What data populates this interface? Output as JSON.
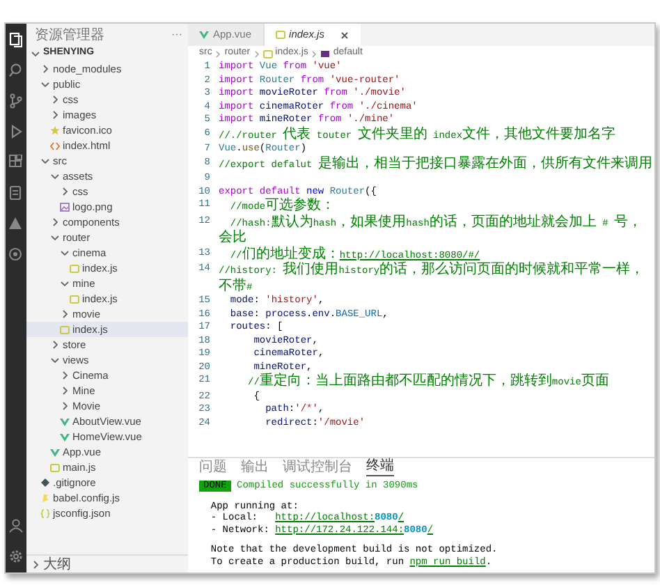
{
  "sidebar": {
    "title": "资源管理器",
    "more": "···",
    "tree": [
      {
        "label": "SHENYING",
        "kind": "folder",
        "expanded": true,
        "selected": false,
        "children": [
          {
            "label": "node_modules",
            "kind": "folder",
            "expanded": false,
            "selected": false
          },
          {
            "label": "public",
            "kind": "folder",
            "expanded": true,
            "selected": false,
            "children": [
              {
                "label": "css",
                "kind": "folder",
                "expanded": false,
                "selected": false
              },
              {
                "label": "images",
                "kind": "folder",
                "expanded": false,
                "selected": false
              },
              {
                "label": "favicon.ico",
                "kind": "ico",
                "selected": false
              },
              {
                "label": "index.html",
                "kind": "html",
                "selected": false
              }
            ]
          },
          {
            "label": "src",
            "kind": "folder",
            "expanded": true,
            "selected": false,
            "children": [
              {
                "label": "assets",
                "kind": "folder",
                "expanded": true,
                "selected": false,
                "children": [
                  {
                    "label": "css",
                    "kind": "folder",
                    "expanded": false,
                    "selected": false
                  },
                  {
                    "label": "logo.png",
                    "kind": "png",
                    "selected": false
                  }
                ]
              },
              {
                "label": "components",
                "kind": "folder",
                "expanded": false,
                "selected": false
              },
              {
                "label": "router",
                "kind": "folder",
                "expanded": true,
                "selected": false,
                "children": [
                  {
                    "label": "cinema",
                    "kind": "folder",
                    "expanded": true,
                    "selected": false,
                    "children": [
                      {
                        "label": "index.js",
                        "kind": "js",
                        "selected": false
                      }
                    ]
                  },
                  {
                    "label": "mine",
                    "kind": "folder",
                    "expanded": true,
                    "selected": false,
                    "children": [
                      {
                        "label": "index.js",
                        "kind": "js",
                        "selected": false
                      }
                    ]
                  },
                  {
                    "label": "movie",
                    "kind": "folder",
                    "expanded": false,
                    "selected": false
                  },
                  {
                    "label": "index.js",
                    "kind": "js",
                    "selected": true
                  }
                ]
              },
              {
                "label": "store",
                "kind": "folder",
                "expanded": false,
                "selected": false
              },
              {
                "label": "views",
                "kind": "folder",
                "expanded": true,
                "selected": false,
                "children": [
                  {
                    "label": "Cinema",
                    "kind": "folder",
                    "expanded": false,
                    "selected": false
                  },
                  {
                    "label": "Mine",
                    "kind": "folder",
                    "expanded": false,
                    "selected": false
                  },
                  {
                    "label": "Movie",
                    "kind": "folder",
                    "expanded": false,
                    "selected": false
                  },
                  {
                    "label": "AboutView.vue",
                    "kind": "vue",
                    "selected": false
                  },
                  {
                    "label": "HomeView.vue",
                    "kind": "vue",
                    "selected": false
                  }
                ]
              },
              {
                "label": "App.vue",
                "kind": "vue",
                "selected": false
              },
              {
                "label": "main.js",
                "kind": "js",
                "selected": false
              }
            ]
          },
          {
            "label": ".gitignore",
            "kind": "git",
            "selected": false
          },
          {
            "label": "babel.config.js",
            "kind": "babel",
            "selected": false
          },
          {
            "label": "jsconfig.json",
            "kind": "json",
            "selected": false
          }
        ]
      }
    ],
    "outline": {
      "label": "大纲",
      "expanded": false
    }
  },
  "editor": {
    "tabs": [
      {
        "label": "App.vue",
        "kind": "vue",
        "selected": false
      },
      {
        "label": "index.js",
        "kind": "js",
        "selected": true
      }
    ],
    "breadcrumb": [
      {
        "label": "src",
        "kind": "folder"
      },
      {
        "label": "router",
        "kind": "folder"
      },
      {
        "label": "index.js",
        "kind": "js"
      },
      {
        "label": "default",
        "kind": "symbol"
      }
    ],
    "lines": [
      {
        "number": "1",
        "tokens": [
          {
            "kind": "keyword",
            "text": "import"
          },
          {
            "kind": "class",
            "text": " Vue "
          },
          {
            "kind": "keyword",
            "text": "from"
          },
          {
            "kind": "string",
            "text": " 'vue'"
          }
        ]
      },
      {
        "number": "2",
        "tokens": [
          {
            "kind": "keyword",
            "text": "import"
          },
          {
            "kind": "class",
            "text": " Router "
          },
          {
            "kind": "keyword",
            "text": "from"
          },
          {
            "kind": "string",
            "text": " 'vue-router'"
          }
        ]
      },
      {
        "number": "3",
        "tokens": [
          {
            "kind": "keyword",
            "text": "import"
          },
          {
            "kind": "variable",
            "text": " movieRoter "
          },
          {
            "kind": "keyword",
            "text": "from"
          },
          {
            "kind": "string",
            "text": " './movie'"
          }
        ]
      },
      {
        "number": "4",
        "tokens": [
          {
            "kind": "keyword",
            "text": "import"
          },
          {
            "kind": "variable",
            "text": " cinemaRoter "
          },
          {
            "kind": "keyword",
            "text": "from"
          },
          {
            "kind": "string",
            "text": " './cinema'"
          }
        ]
      },
      {
        "number": "5",
        "tokens": [
          {
            "kind": "keyword",
            "text": "import"
          },
          {
            "kind": "variable",
            "text": " mineRoter "
          },
          {
            "kind": "keyword",
            "text": "from"
          },
          {
            "kind": "string",
            "text": " './mine'"
          }
        ]
      },
      {
        "number": "6",
        "tokens": [
          {
            "kind": "comment",
            "text": "//./router 代表 touter 文件夹里的 index文件，其他文件要加名字"
          }
        ]
      },
      {
        "number": "7",
        "tokens": [
          {
            "kind": "class",
            "text": "Vue"
          },
          {
            "kind": "plain",
            "text": "."
          },
          {
            "kind": "function",
            "text": "use"
          },
          {
            "kind": "plain",
            "text": "("
          },
          {
            "kind": "class",
            "text": "Router"
          },
          {
            "kind": "plain",
            "text": ")"
          }
        ]
      },
      {
        "number": "8",
        "tokens": [
          {
            "kind": "comment",
            "text": "//export defalut 是输出，相当于把接口暴露在外面，供所有文件来调用"
          }
        ]
      },
      {
        "number": "9"
      },
      {
        "number": "10",
        "tokens": [
          {
            "kind": "keyword",
            "text": "export default"
          },
          {
            "kind": "storage",
            "text": " new"
          },
          {
            "kind": "class",
            "text": " Router"
          },
          {
            "kind": "plain",
            "text": "({"
          }
        ]
      },
      {
        "number": "11",
        "tokens": [
          {
            "kind": "comment",
            "text": "  //mode可选参数："
          }
        ]
      },
      {
        "number": "12",
        "tokens": [
          {
            "kind": "comment",
            "text": "  //hash:默认为hash，如果使用hash的话，页面的地址就会加上 # 号，会比"
          }
        ]
      },
      {
        "number": "13",
        "tokens": [
          {
            "kind": "comment",
            "text": "  //们的地址变成："
          },
          {
            "kind": "link",
            "text": "http://localhost:8080/#/"
          }
        ]
      },
      {
        "number": "14",
        "tokens": [
          {
            "kind": "comment",
            "text": "//history: 我们使用history的话，那么访问页面的时候就和平常一样，不带#"
          }
        ]
      },
      {
        "number": "15",
        "tokens": [
          {
            "kind": "variable",
            "text": "  mode"
          },
          {
            "kind": "plain",
            "text": ": "
          },
          {
            "kind": "string",
            "text": "'history'"
          },
          {
            "kind": "plain",
            "text": ","
          }
        ]
      },
      {
        "number": "16",
        "tokens": [
          {
            "kind": "variable",
            "text": "  base"
          },
          {
            "kind": "plain",
            "text": ": "
          },
          {
            "kind": "variable",
            "text": "process"
          },
          {
            "kind": "plain",
            "text": "."
          },
          {
            "kind": "variable",
            "text": "env"
          },
          {
            "kind": "plain",
            "text": "."
          },
          {
            "kind": "constant",
            "text": "BASE_URL"
          },
          {
            "kind": "plain",
            "text": ","
          }
        ]
      },
      {
        "number": "17",
        "tokens": [
          {
            "kind": "variable",
            "text": "  routes"
          },
          {
            "kind": "plain",
            "text": ": ["
          }
        ]
      },
      {
        "number": "18",
        "tokens": [
          {
            "kind": "variable",
            "text": "      movieRoter"
          },
          {
            "kind": "plain",
            "text": ","
          }
        ]
      },
      {
        "number": "19",
        "tokens": [
          {
            "kind": "variable",
            "text": "      cinemaRoter"
          },
          {
            "kind": "plain",
            "text": ","
          }
        ]
      },
      {
        "number": "20",
        "tokens": [
          {
            "kind": "variable",
            "text": "      mineRoter"
          },
          {
            "kind": "plain",
            "text": ","
          }
        ]
      },
      {
        "number": "21",
        "tokens": [
          {
            "kind": "comment",
            "text": "     //重定向：当上面路由都不匹配的情况下，跳转到movie页面"
          }
        ]
      },
      {
        "number": "22",
        "tokens": [
          {
            "kind": "plain",
            "text": "      {"
          }
        ]
      },
      {
        "number": "23",
        "tokens": [
          {
            "kind": "variable",
            "text": "        path"
          },
          {
            "kind": "plain",
            "text": ":"
          },
          {
            "kind": "string",
            "text": "'/*'"
          },
          {
            "kind": "plain",
            "text": ","
          }
        ]
      },
      {
        "number": "24",
        "tokens": [
          {
            "kind": "variable",
            "text": "        redirect"
          },
          {
            "kind": "plain",
            "text": ":"
          },
          {
            "kind": "string",
            "text": "'/movie'"
          }
        ]
      }
    ]
  },
  "panel": {
    "tabs": [
      {
        "label": "问题",
        "selected": false
      },
      {
        "label": "输出",
        "selected": false
      },
      {
        "label": "调试控制台",
        "selected": false
      },
      {
        "label": "终端",
        "selected": true
      }
    ],
    "terminal": [
      [
        {
          "tokens": [
            {
              "kind": "badge",
              "text": "DONE"
            },
            {
              "kind": "success",
              "text": " Compiled successfully in 3090ms"
            }
          ]
        }
      ],
      [
        {
          "tokens": [
            {
              "kind": "plain",
              "text": "  App running at:"
            }
          ]
        },
        {
          "tokens": [
            {
              "kind": "plain",
              "text": "  - Local:   "
            },
            {
              "kind": "link",
              "text": "http://localhost:"
            },
            {
              "kind": "port",
              "text": "8080"
            },
            {
              "kind": "link",
              "text": "/"
            }
          ]
        },
        {
          "tokens": [
            {
              "kind": "plain",
              "text": "  - Network: "
            },
            {
              "kind": "link",
              "text": "http://172.24.122.144:"
            },
            {
              "kind": "port",
              "text": "8080"
            },
            {
              "kind": "link",
              "text": "/"
            }
          ]
        }
      ],
      [
        {
          "tokens": [
            {
              "kind": "plain",
              "text": "  Note that the development build is not optimized."
            }
          ]
        },
        {
          "tokens": [
            {
              "kind": "plain",
              "text": "  To create a production build, run "
            },
            {
              "kind": "link",
              "text": "npm run build"
            },
            {
              "kind": "plain",
              "text": "."
            }
          ]
        }
      ]
    ]
  }
}
